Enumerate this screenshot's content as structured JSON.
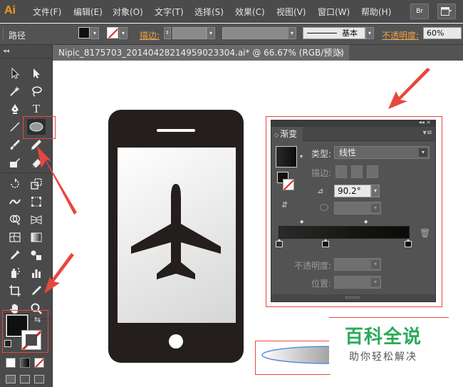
{
  "app": {
    "logo": "Ai"
  },
  "menubar": {
    "items": [
      "文件(F)",
      "编辑(E)",
      "对象(O)",
      "文字(T)",
      "选择(S)",
      "效果(C)",
      "视图(V)",
      "窗口(W)",
      "帮助(H)"
    ],
    "right_buttons": [
      "Br",
      "layout-icon"
    ]
  },
  "controlbar": {
    "object_label": "路径",
    "stroke_label": "描边:",
    "stroke_style": "基本",
    "opacity_label": "不透明度:",
    "opacity_value": "60%"
  },
  "document_tab": {
    "title": "Nipic_8175703_20140428214959023304.ai* @ 66.67% (RGB/预览)",
    "close": "×"
  },
  "toolbox": {
    "collapse": "◂◂",
    "selected_tool": "ellipse-tool"
  },
  "gradient_panel": {
    "header_buttons": "◂◂ ×",
    "tab_label": "渐变",
    "type_label": "类型:",
    "type_value": "线性",
    "stroke_label": "描边:",
    "angle_value": "90.2°",
    "opacity_label": "不透明度:",
    "location_label": "位置:",
    "gradient_colors": [
      "#2a2a2a",
      "#151510",
      "#0b0b07"
    ]
  },
  "watermark": {
    "title": "百科全说",
    "subtitle": "助你轻松解决"
  },
  "colors": {
    "phone_body": "#241f1d",
    "annotation": "#e8473e",
    "accent_orange": "#f0a244",
    "watermark_green": "#2aaa5a"
  }
}
